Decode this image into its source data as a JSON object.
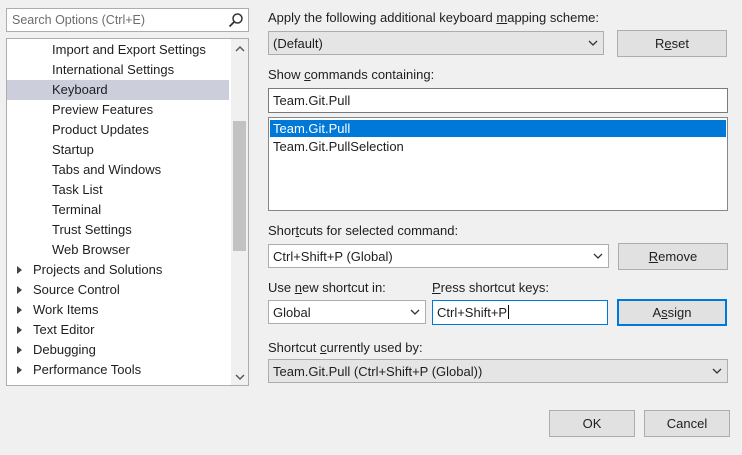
{
  "search": {
    "placeholder": "Search Options (Ctrl+E)"
  },
  "tree": {
    "items": [
      {
        "label": "Import and Export Settings",
        "level": "sub",
        "selected": false
      },
      {
        "label": "International Settings",
        "level": "sub",
        "selected": false
      },
      {
        "label": "Keyboard",
        "level": "sub",
        "selected": true
      },
      {
        "label": "Preview Features",
        "level": "sub",
        "selected": false
      },
      {
        "label": "Product Updates",
        "level": "sub",
        "selected": false
      },
      {
        "label": "Startup",
        "level": "sub",
        "selected": false
      },
      {
        "label": "Tabs and Windows",
        "level": "sub",
        "selected": false
      },
      {
        "label": "Task List",
        "level": "sub",
        "selected": false
      },
      {
        "label": "Terminal",
        "level": "sub",
        "selected": false
      },
      {
        "label": "Trust Settings",
        "level": "sub",
        "selected": false
      },
      {
        "label": "Web Browser",
        "level": "sub",
        "selected": false
      },
      {
        "label": "Projects and Solutions",
        "level": "top",
        "selected": false
      },
      {
        "label": "Source Control",
        "level": "top",
        "selected": false
      },
      {
        "label": "Work Items",
        "level": "top",
        "selected": false
      },
      {
        "label": "Text Editor",
        "level": "top",
        "selected": false
      },
      {
        "label": "Debugging",
        "level": "top",
        "selected": false
      },
      {
        "label": "Performance Tools",
        "level": "top",
        "selected": false
      }
    ]
  },
  "mapping": {
    "label_pre": "Apply the following additional keyboard ",
    "label_key": "m",
    "label_post": "apping scheme:",
    "value": "(Default)",
    "reset_key": "e",
    "reset_pre": "R",
    "reset_post": "set"
  },
  "commands": {
    "label_pre": "Show ",
    "label_key": "c",
    "label_post": "ommands containing:",
    "filter_value": "Team.Git.Pull",
    "list": [
      {
        "label": "Team.Git.Pull",
        "selected": true
      },
      {
        "label": "Team.Git.PullSelection",
        "selected": false
      }
    ]
  },
  "shortcuts": {
    "label_pre": "Shor",
    "label_key": "t",
    "label_post": "cuts for selected command:",
    "value": "Ctrl+Shift+P (Global)",
    "remove_key": "R",
    "remove_post": "emove"
  },
  "new_shortcut": {
    "label_pre": "Use ",
    "label_key": "n",
    "label_post": "ew shortcut in:",
    "scope_value": "Global",
    "keys_label_key": "P",
    "keys_label_post": "ress shortcut keys:",
    "keys_value": "Ctrl+Shift+P",
    "assign_pre": "A",
    "assign_key": "s",
    "assign_post": "sign"
  },
  "used_by": {
    "label_pre": "Shortcut ",
    "label_key": "c",
    "label_post": "urrently used by:",
    "value": "Team.Git.Pull (Ctrl+Shift+P (Global))"
  },
  "footer": {
    "ok_label": "OK",
    "cancel_label": "Cancel"
  },
  "colors": {
    "selection": "#0078d7",
    "tree_selection": "#cccedb",
    "window_bg": "#f0f0f0"
  }
}
